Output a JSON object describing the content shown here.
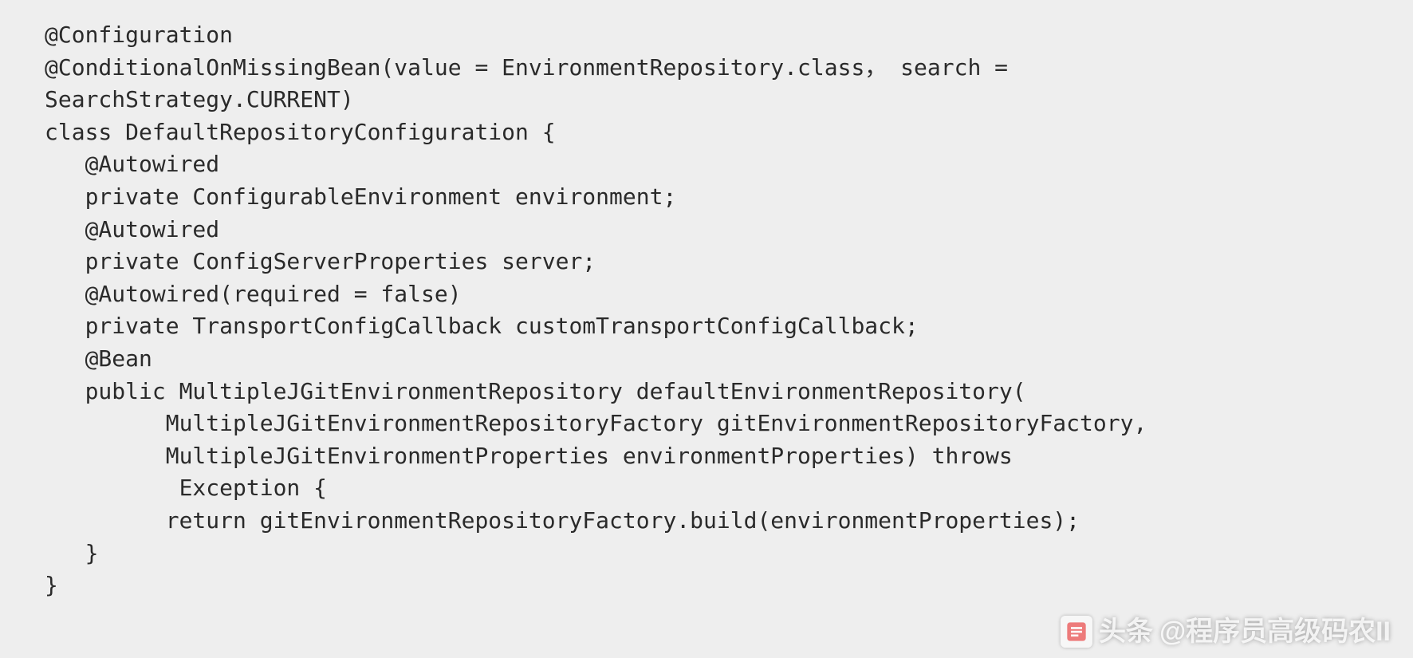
{
  "code": {
    "lines": [
      "@Configuration",
      "@ConditionalOnMissingBean(value = EnvironmentRepository.class， search =",
      "SearchStrategy.CURRENT)",
      "class DefaultRepositoryConfiguration {",
      "   @Autowired",
      "   private ConfigurableEnvironment environment;",
      "   @Autowired",
      "   private ConfigServerProperties server;",
      "   @Autowired(required = false)",
      "   private TransportConfigCallback customTransportConfigCallback;",
      "   @Bean",
      "   public MultipleJGitEnvironmentRepository defaultEnvironmentRepository(",
      "         MultipleJGitEnvironmentRepositoryFactory gitEnvironmentRepositoryFactory,",
      "         MultipleJGitEnvironmentProperties environmentProperties) throws",
      "          Exception {",
      "         return gitEnvironmentRepositoryFactory.build(environmentProperties);",
      "   }",
      "}"
    ]
  },
  "watermark": {
    "prefix": "头条",
    "handle": "@程序员高级码农II"
  }
}
